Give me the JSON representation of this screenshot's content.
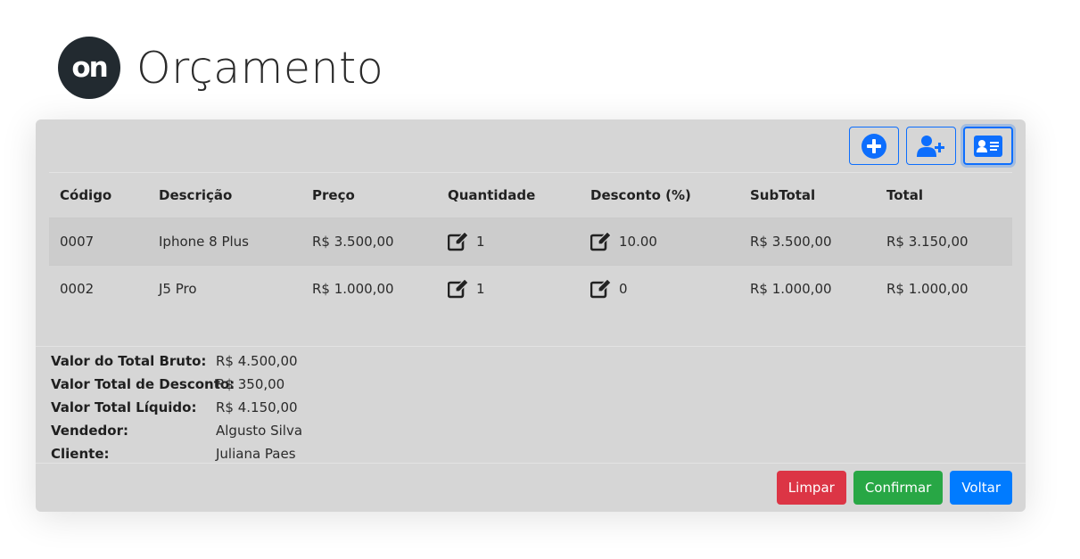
{
  "header": {
    "logo_text": "on",
    "title": "Orçamento"
  },
  "toolbar": {
    "icons": [
      "plus-circle-icon",
      "user-plus-icon",
      "id-card-icon"
    ],
    "accent": "#0d6efd"
  },
  "table": {
    "columns": [
      "Código",
      "Descrição",
      "Preço",
      "Quantidade",
      "Desconto (%)",
      "SubTotal",
      "Total"
    ],
    "rows": [
      {
        "code": "0007",
        "description": "Iphone 8 Plus",
        "price": "R$ 3.500,00",
        "quantity": "1",
        "discount": "10.00",
        "subtotal": "R$ 3.500,00",
        "total": "R$ 3.150,00"
      },
      {
        "code": "0002",
        "description": "J5 Pro",
        "price": "R$ 1.000,00",
        "quantity": "1",
        "discount": "0",
        "subtotal": "R$ 1.000,00",
        "total": "R$ 1.000,00"
      }
    ]
  },
  "summary": {
    "gross_label": "Valor do Total Bruto:",
    "gross_value": "R$ 4.500,00",
    "discount_label": "Valor Total de Desconto:",
    "discount_value": "R$ 350,00",
    "net_label": "Valor Total Líquido:",
    "net_value": "R$ 4.150,00",
    "seller_label": "Vendedor:",
    "seller_value": "Algusto Silva",
    "client_label": "Cliente:",
    "client_value": "Juliana Paes"
  },
  "actions": {
    "clear": "Limpar",
    "confirm": "Confirmar",
    "back": "Voltar"
  },
  "colors": {
    "danger": "#dc3545",
    "success": "#28a745",
    "primary": "#007bff",
    "panel": "#d6d6d6"
  }
}
